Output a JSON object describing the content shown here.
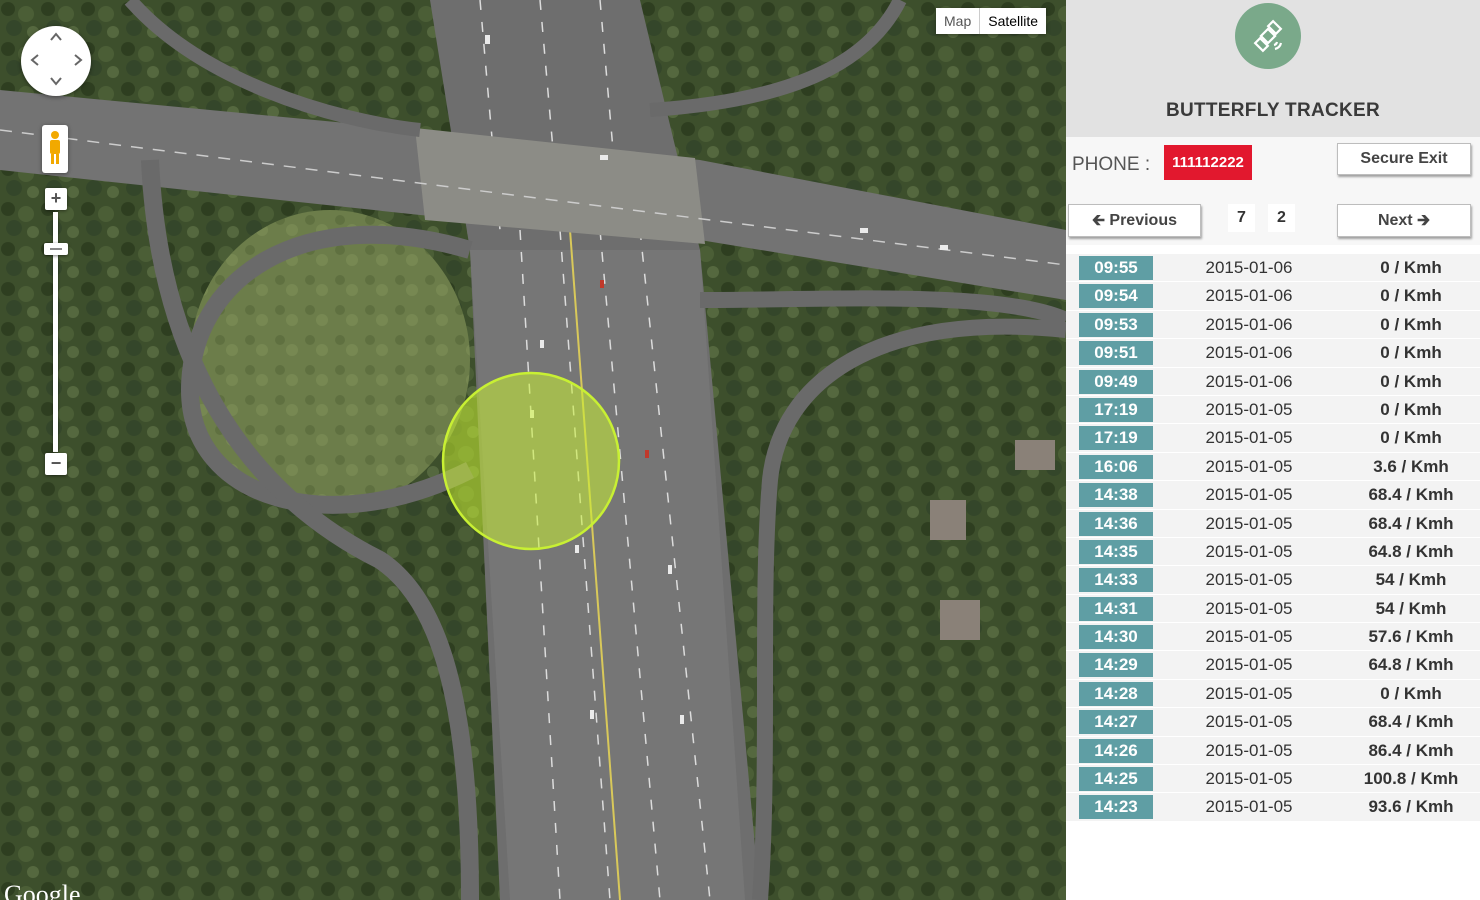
{
  "map": {
    "type_buttons": [
      "Map",
      "Satellite"
    ],
    "active_type": "Satellite",
    "zoom_in_label": "+",
    "zoom_out_label": "−",
    "attribution": "Google",
    "marker": {
      "icon": "location-circle",
      "color": "#c8f033"
    }
  },
  "panel": {
    "brand": "BUTTERFLY TRACKER",
    "logo_icon": "satellite-icon",
    "phone_label": "PHONE :",
    "phone_number": "111112222",
    "secure_exit_label": "Secure Exit",
    "previous_label": "Previous",
    "next_label": "Next",
    "pages": [
      "7",
      "2"
    ],
    "colors": {
      "accent": "#5f9ea4",
      "phone_badge": "#e2182e",
      "logo_bg": "#7aa98a"
    },
    "records": [
      {
        "time": "09:55",
        "date": "2015-01-06",
        "speed": "0 / Kmh"
      },
      {
        "time": "09:54",
        "date": "2015-01-06",
        "speed": "0 / Kmh"
      },
      {
        "time": "09:53",
        "date": "2015-01-06",
        "speed": "0 / Kmh"
      },
      {
        "time": "09:51",
        "date": "2015-01-06",
        "speed": "0 / Kmh"
      },
      {
        "time": "09:49",
        "date": "2015-01-06",
        "speed": "0 / Kmh"
      },
      {
        "time": "17:19",
        "date": "2015-01-05",
        "speed": "0 / Kmh"
      },
      {
        "time": "17:19",
        "date": "2015-01-05",
        "speed": "0 / Kmh"
      },
      {
        "time": "16:06",
        "date": "2015-01-05",
        "speed": "3.6 / Kmh"
      },
      {
        "time": "14:38",
        "date": "2015-01-05",
        "speed": "68.4 / Kmh"
      },
      {
        "time": "14:36",
        "date": "2015-01-05",
        "speed": "68.4 / Kmh"
      },
      {
        "time": "14:35",
        "date": "2015-01-05",
        "speed": "64.8 / Kmh"
      },
      {
        "time": "14:33",
        "date": "2015-01-05",
        "speed": "54 / Kmh"
      },
      {
        "time": "14:31",
        "date": "2015-01-05",
        "speed": "54 / Kmh"
      },
      {
        "time": "14:30",
        "date": "2015-01-05",
        "speed": "57.6 / Kmh"
      },
      {
        "time": "14:29",
        "date": "2015-01-05",
        "speed": "64.8 / Kmh"
      },
      {
        "time": "14:28",
        "date": "2015-01-05",
        "speed": "0 / Kmh"
      },
      {
        "time": "14:27",
        "date": "2015-01-05",
        "speed": "68.4 / Kmh"
      },
      {
        "time": "14:26",
        "date": "2015-01-05",
        "speed": "86.4 / Kmh"
      },
      {
        "time": "14:25",
        "date": "2015-01-05",
        "speed": "100.8 / Kmh"
      },
      {
        "time": "14:23",
        "date": "2015-01-05",
        "speed": "93.6 / Kmh"
      }
    ]
  }
}
